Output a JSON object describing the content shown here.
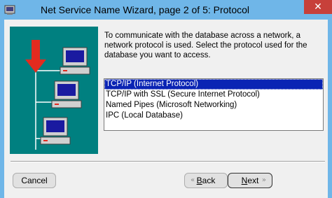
{
  "window": {
    "title": "Net Service Name Wizard, page 2 of 5: Protocol",
    "close_glyph": "✕"
  },
  "intro_text": "To communicate with the database across a network, a network protocol is used.  Select the protocol used for the database you want to access.",
  "protocols": [
    {
      "label": "TCP/IP (Internet Protocol)",
      "selected": true
    },
    {
      "label": "TCP/IP with SSL (Secure Internet Protocol)",
      "selected": false
    },
    {
      "label": "Named Pipes (Microsoft Networking)",
      "selected": false
    },
    {
      "label": "IPC (Local Database)",
      "selected": false
    }
  ],
  "buttons": {
    "cancel": "Cancel",
    "back_mnemonic": "B",
    "back_rest": "ack",
    "next_mnemonic": "N",
    "next_rest": "ext",
    "back_chevron": "«",
    "next_chevron": "»"
  },
  "colors": {
    "titlebar": "#6fb6e8",
    "art_background": "#008080",
    "selection": "#0a24b4",
    "arrow": "#e32b1f",
    "close": "#c7403a"
  },
  "icons": [
    "app-icon",
    "close-icon",
    "network-illustration",
    "computer-icon",
    "red-arrow-icon",
    "back-chevron-icon",
    "next-chevron-icon"
  ]
}
